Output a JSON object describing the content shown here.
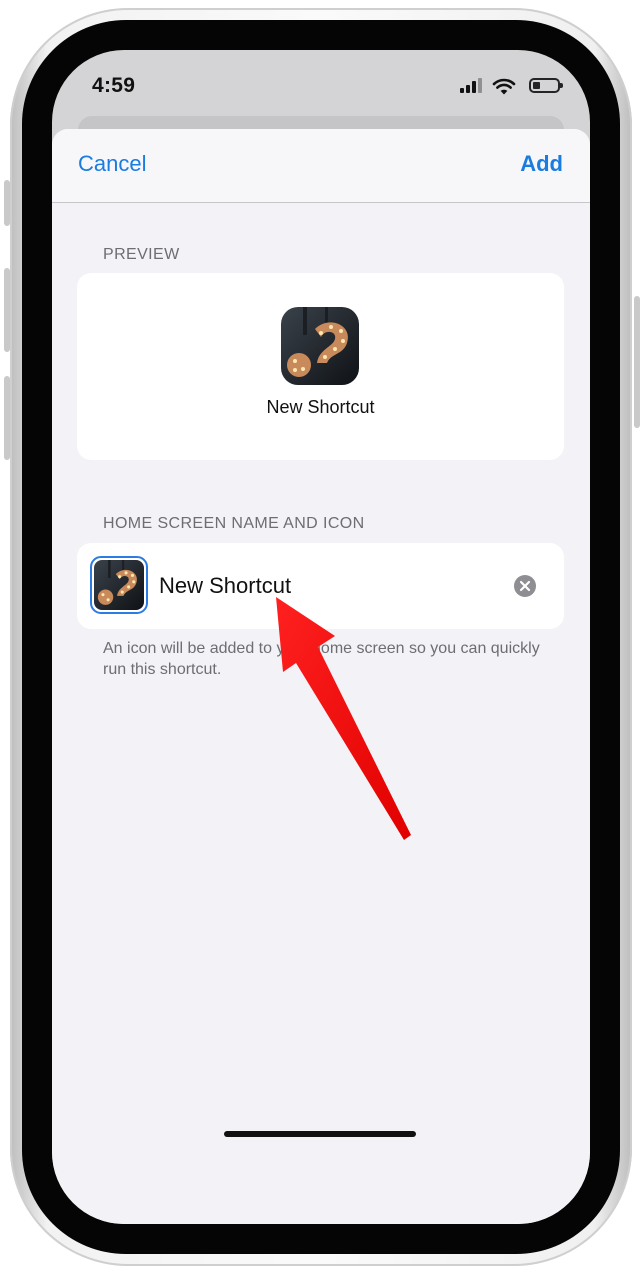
{
  "status_bar": {
    "time": "4:59",
    "icons": [
      "signal-icon",
      "wifi-icon",
      "battery-icon"
    ]
  },
  "nav": {
    "cancel_label": "Cancel",
    "add_label": "Add"
  },
  "preview": {
    "section_label": "PREVIEW",
    "shortcut_name": "New Shortcut",
    "icon": "marquee-question-mark-icon"
  },
  "home_screen": {
    "section_label": "HOME SCREEN NAME AND ICON",
    "name_value": "New Shortcut",
    "icon": "marquee-question-mark-icon",
    "clear_icon": "clear-icon",
    "note": "An icon will be added to your home screen so you can quickly run this shortcut."
  },
  "annotation": {
    "icon": "red-arrow-icon",
    "color": "#ff1a1a"
  },
  "colors": {
    "accent": "#1a7ce0",
    "sheet_background": "#f2f2f7",
    "card_background": "#ffffff",
    "secondary_text": "#6d6d72"
  }
}
